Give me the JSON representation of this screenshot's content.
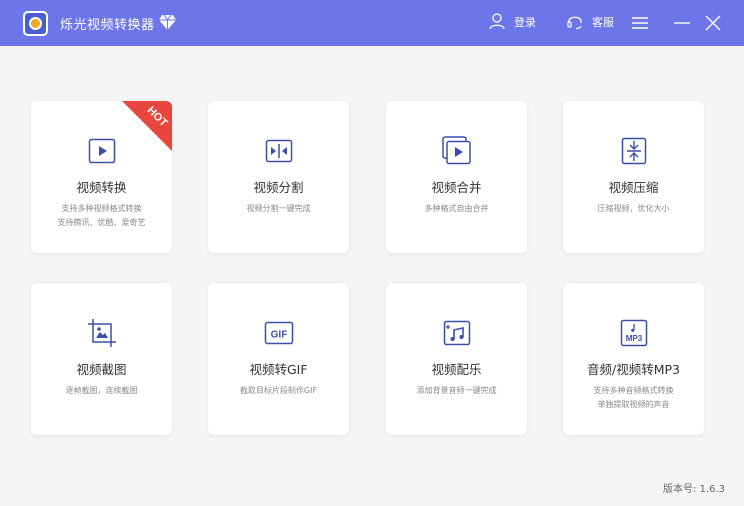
{
  "app": {
    "title": "烁光视频转换器"
  },
  "header": {
    "login_label": "登录",
    "service_label": "客服"
  },
  "cards": [
    {
      "title": "视频转换",
      "desc1": "支持多种视频格式转换",
      "desc2": "支持腾讯、优酷、爱奇艺",
      "badge": "HOT"
    },
    {
      "title": "视频分割",
      "desc1": "视频分割一键完成",
      "desc2": ""
    },
    {
      "title": "视频合并",
      "desc1": "多种格式自由合并",
      "desc2": ""
    },
    {
      "title": "视频压缩",
      "desc1": "压缩视频，优化大小",
      "desc2": ""
    },
    {
      "title": "视频截图",
      "desc1": "逐帧截图，连续截图",
      "desc2": ""
    },
    {
      "title": "视频转GIF",
      "desc1": "截取目标片段制作GIF",
      "desc2": "",
      "icon_text": "GIF"
    },
    {
      "title": "视频配乐",
      "desc1": "添加背景音频一键完成",
      "desc2": ""
    },
    {
      "title": "音频/视频转MP3",
      "desc1": "支持多种音频格式转换",
      "desc2": "单独提取视频的声音",
      "icon_text": "MP3"
    }
  ],
  "footer": {
    "version": "版本号: 1.6.3"
  },
  "colors": {
    "accent": "#6c76e8",
    "icon": "#3a4fa8",
    "hot": "#e8453c"
  },
  "icons": {
    "logo": "app-logo-icon",
    "vip": "diamond-icon",
    "login": "user-icon",
    "service": "headset-icon",
    "menu": "menu-icon",
    "minimize": "minimize-icon",
    "close": "close-icon"
  }
}
